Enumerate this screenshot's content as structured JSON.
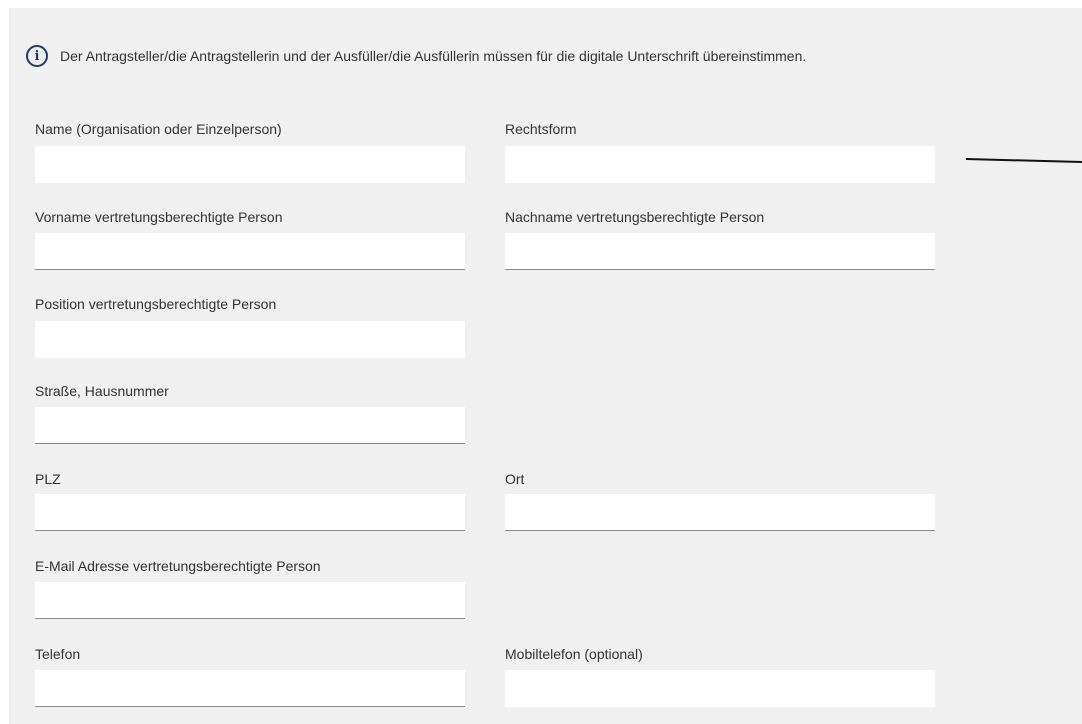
{
  "info": {
    "icon": "info-icon",
    "text": "Der Antragsteller/die Antragstellerin und der Ausfüller/die Ausfüllerin müssen für die digitale Unterschrift übereinstimmen."
  },
  "fields": {
    "name": {
      "label": "Name (Organisation oder Einzelperson)",
      "value": ""
    },
    "rechtsform": {
      "label": "Rechtsform",
      "value": ""
    },
    "vorname": {
      "label": "Vorname vertretungsberechtigte Person",
      "value": ""
    },
    "nachname": {
      "label": "Nachname vertretungsberechtigte Person",
      "value": ""
    },
    "position": {
      "label": "Position vertretungsberechtigte Person",
      "value": ""
    },
    "strasse": {
      "label": "Straße, Hausnummer",
      "value": ""
    },
    "plz": {
      "label": "PLZ",
      "value": ""
    },
    "ort": {
      "label": "Ort",
      "value": ""
    },
    "email": {
      "label": "E-Mail Adresse vertretungsberechtigte Person",
      "value": ""
    },
    "telefon": {
      "label": "Telefon",
      "value": ""
    },
    "mobiltelefon": {
      "label": "Mobiltelefon (optional)",
      "value": ""
    }
  }
}
